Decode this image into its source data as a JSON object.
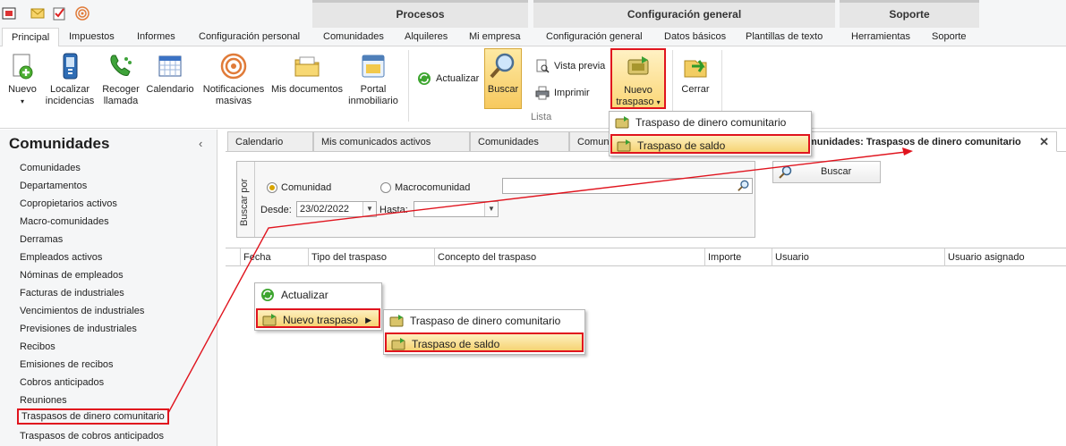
{
  "ribbon_tabs": [
    "Principal",
    "Impuestos",
    "Informes",
    "Configuración personal",
    "Comunidades",
    "Alquileres",
    "Mi empresa",
    "Configuración general",
    "Datos básicos",
    "Plantillas de texto",
    "Herramientas",
    "Soporte"
  ],
  "context_groups": [
    "Procesos",
    "Configuración general",
    "Soporte"
  ],
  "ribbon": {
    "nuevo": "Nuevo",
    "localizar_1": "Localizar",
    "localizar_2": "incidencias",
    "recoger_1": "Recoger",
    "recoger_2": "llamada",
    "calendario": "Calendario",
    "notif_1": "Notificaciones",
    "notif_2": "masivas",
    "mis_documentos": "Mis documentos",
    "portal_1": "Portal",
    "portal_2": "inmobiliario",
    "actualizar": "Actualizar",
    "buscar": "Buscar",
    "vista_previa": "Vista previa",
    "imprimir": "Imprimir",
    "nuevo_traspaso_1": "Nuevo",
    "nuevo_traspaso_2": "traspaso",
    "cerrar": "Cerrar",
    "group_lista": "Lista"
  },
  "ribbon_menu": {
    "item1": "Traspaso de dinero comunitario",
    "item2": "Traspaso de saldo"
  },
  "sidebar": {
    "title": "Comunidades",
    "collapse": "‹",
    "items": [
      "Comunidades",
      "Departamentos",
      "Copropietarios activos",
      "Macro-comunidades",
      "Derramas",
      "Empleados activos",
      "Nóminas de empleados",
      "Facturas de industriales",
      "Vencimientos de industriales",
      "Previsiones de industriales",
      "Recibos",
      "Emisiones de recibos",
      "Cobros anticipados",
      "Reuniones",
      "Traspasos de dinero comunitario",
      "Traspasos de cobros anticipados"
    ]
  },
  "doc_tabs": {
    "t1": "Calendario",
    "t2": "Mis comunicados activos",
    "t3": "Comunidades",
    "t4": "Comuni",
    "active": "munidades: Traspasos de dinero comunitario",
    "close": "✕"
  },
  "filter": {
    "side_label": "Buscar por",
    "radio1": "Comunidad",
    "radio2": "Macrocomunidad",
    "desde_label": "Desde:",
    "desde_value": "23/02/2022",
    "hasta_label": "Hasta:",
    "hasta_value": "",
    "search_button": "Buscar"
  },
  "grid_columns": [
    "Fecha",
    "Tipo del traspaso",
    "Concepto del traspaso",
    "Importe",
    "Usuario",
    "Usuario asignado"
  ],
  "context_menu": {
    "actualizar": "Actualizar",
    "nuevo_traspaso": "Nuevo traspaso",
    "sub1": "Traspaso de dinero comunitario",
    "sub2": "Traspaso de saldo"
  },
  "colors": {
    "accent_highlight": "#e0141e",
    "hover_gold": "#f6d373"
  }
}
